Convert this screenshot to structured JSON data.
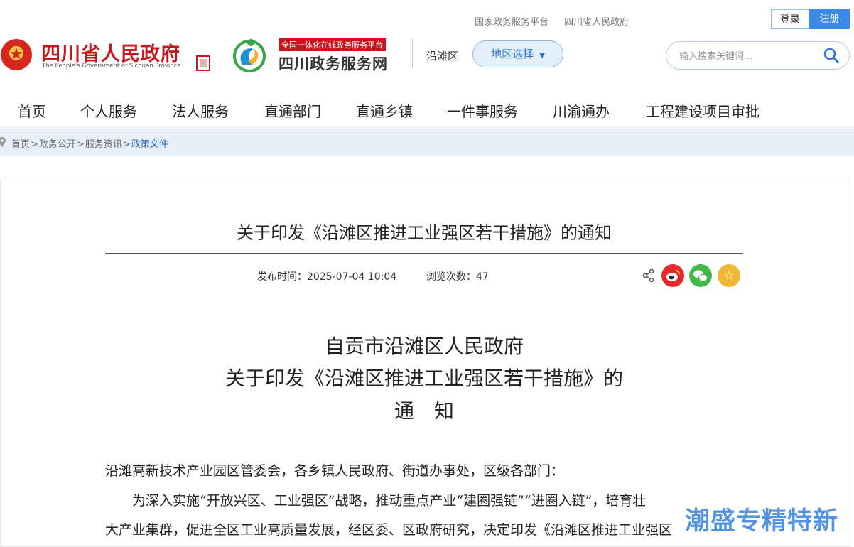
{
  "top_links": [
    "国家政务服务平台",
    "四川省人民政府"
  ],
  "auth": {
    "login": "登录",
    "register": "注册"
  },
  "header": {
    "gov_title": "四川省人民政府",
    "gov_subtitle": "The People's Government of Sichuan Province",
    "service_tag": "全国一体化在线政务服务平台",
    "service_title": "四川政务服务网",
    "current_region": "沿滩区",
    "region_button": "地区选择",
    "search_placeholder": "输入搜索关键词..."
  },
  "nav": [
    "首页",
    "个人服务",
    "法人服务",
    "直通部门",
    "直通乡镇",
    "一件事服务",
    "川渝通办",
    "工程建设项目审批"
  ],
  "breadcrumb": {
    "items": [
      "首页",
      "政务公开",
      "服务资讯"
    ],
    "current": "政策文件",
    "separator": ">"
  },
  "article": {
    "title": "关于印发《沿滩区推进工业强区若干措施》的通知",
    "publish_label": "发布时间：",
    "publish_time": "2025-07-04 10:04",
    "views_label": "浏览次数：",
    "views": "47",
    "doc_heading": [
      "自贡市沿滩区人民政府",
      "关于印发《沿滩区推进工业强区若干措施》的",
      "通　知"
    ],
    "paragraphs": [
      "沿滩高新技术产业园区管委会，各乡镇人民政府、街道办事处，区级各部门：",
      "　　为深入实施“开放兴区、工业强区”战略，推动重点产业“建圈强链”“进圈入链”，培育壮",
      "大产业集群，促进全区工业高质量发展，经区委、区政府研究，决定印发《沿滩区推进工业强区"
    ]
  },
  "share": {
    "icons": [
      "share-icon",
      "weibo-icon",
      "wechat-icon",
      "favorite-icon"
    ]
  },
  "watermark": "潮盛专精特新",
  "colors": {
    "brand_red": "#c8161d",
    "accent_blue": "#3b8ae6",
    "crumb_bg": "#e8eff8"
  }
}
